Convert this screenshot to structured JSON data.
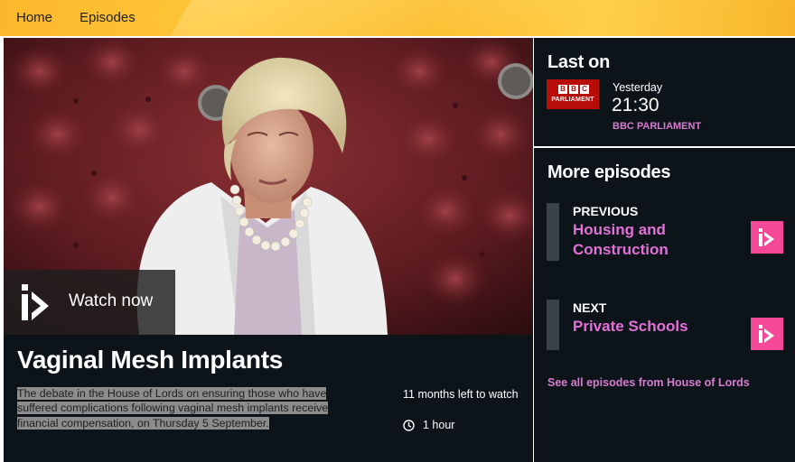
{
  "nav": {
    "items": [
      {
        "label": "Home"
      },
      {
        "label": "Episodes"
      }
    ]
  },
  "programme": {
    "watch_label": "Watch now",
    "title": "Vaginal Mesh Implants",
    "synopsis": "The debate in the House of Lords on ensuring those who have suffered complications following vaginal mesh implants receive financial compensation, on Thursday 5 September.",
    "availability": "11 months left to watch",
    "duration": "1 hour"
  },
  "last_on": {
    "heading": "Last on",
    "logo_letters": [
      "B",
      "B",
      "C"
    ],
    "logo_subtitle": "PARLIAMENT",
    "day": "Yesterday",
    "time": "21:30",
    "channel": "BBC PARLIAMENT"
  },
  "more_episodes": {
    "heading": "More episodes",
    "previous": {
      "kicker": "PREVIOUS",
      "title": "Housing and Construction"
    },
    "next": {
      "kicker": "NEXT",
      "title": "Private Schools"
    },
    "see_all": "See all episodes from House of Lords"
  },
  "colors": {
    "accent_pink": "#f54997",
    "link_pink": "#e370d9",
    "panel_bg": "#0d1419",
    "bbc_red": "#b80c09"
  },
  "icons": {
    "watch": "iplayer-play-icon",
    "clock": "clock-icon",
    "episode_play": "iplayer-play-icon"
  }
}
